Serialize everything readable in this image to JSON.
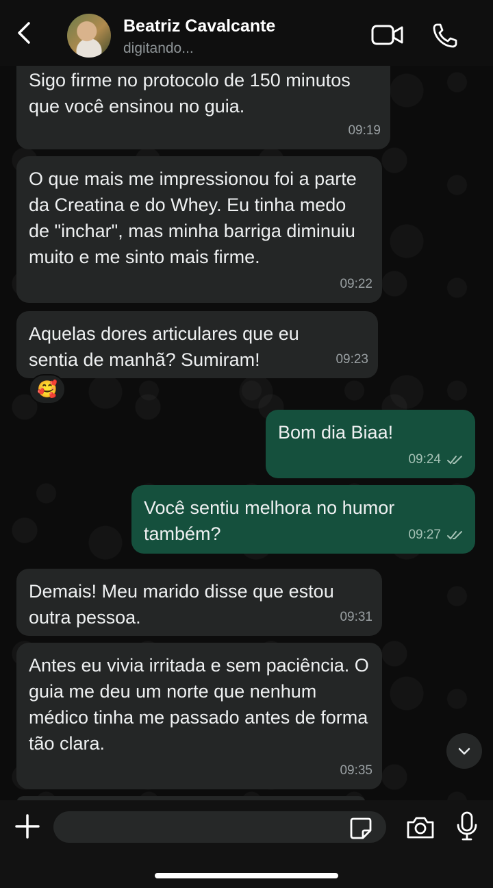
{
  "header": {
    "contact_name": "Beatriz Cavalcante",
    "status": "digitando...",
    "back_icon": "chevron-left-icon",
    "video_icon": "video-camera-icon",
    "call_icon": "phone-icon"
  },
  "messages": [
    {
      "direction": "in",
      "text": "Sigo firme no protocolo de 150 minutos que você ensinou no guia.",
      "time": "09:19"
    },
    {
      "direction": "in",
      "text": "O que mais me impressionou foi a parte da Creatina e do Whey. Eu tinha medo de \"inchar\", mas minha barriga diminuiu muito e me sinto mais firme.",
      "time": "09:22"
    },
    {
      "direction": "in",
      "text": "Aquelas dores articulares que eu sentia de manhã? Sumiram!",
      "time": "09:23",
      "reaction": "🥰"
    },
    {
      "direction": "out",
      "text": "Bom dia Biaa!",
      "time": "09:24",
      "status": "read"
    },
    {
      "direction": "out",
      "text": "Você sentiu melhora no humor também?",
      "time": "09:27",
      "status": "read"
    },
    {
      "direction": "in",
      "text": "Demais! Meu marido disse que estou outra pessoa.",
      "time": "09:31"
    },
    {
      "direction": "in",
      "text": "Antes eu vivia irritada e sem paciência. O guia me deu um norte que nenhum médico tinha me passado antes de forma tão clara.",
      "time": "09:35"
    }
  ],
  "composer": {
    "placeholder": "",
    "plus_icon": "plus-icon",
    "sticker_icon": "sticker-icon",
    "camera_icon": "camera-icon",
    "mic_icon": "microphone-icon"
  },
  "colors": {
    "incoming_bubble": "#242626",
    "outgoing_bubble": "#15503d",
    "background": "#0c0c0c"
  }
}
